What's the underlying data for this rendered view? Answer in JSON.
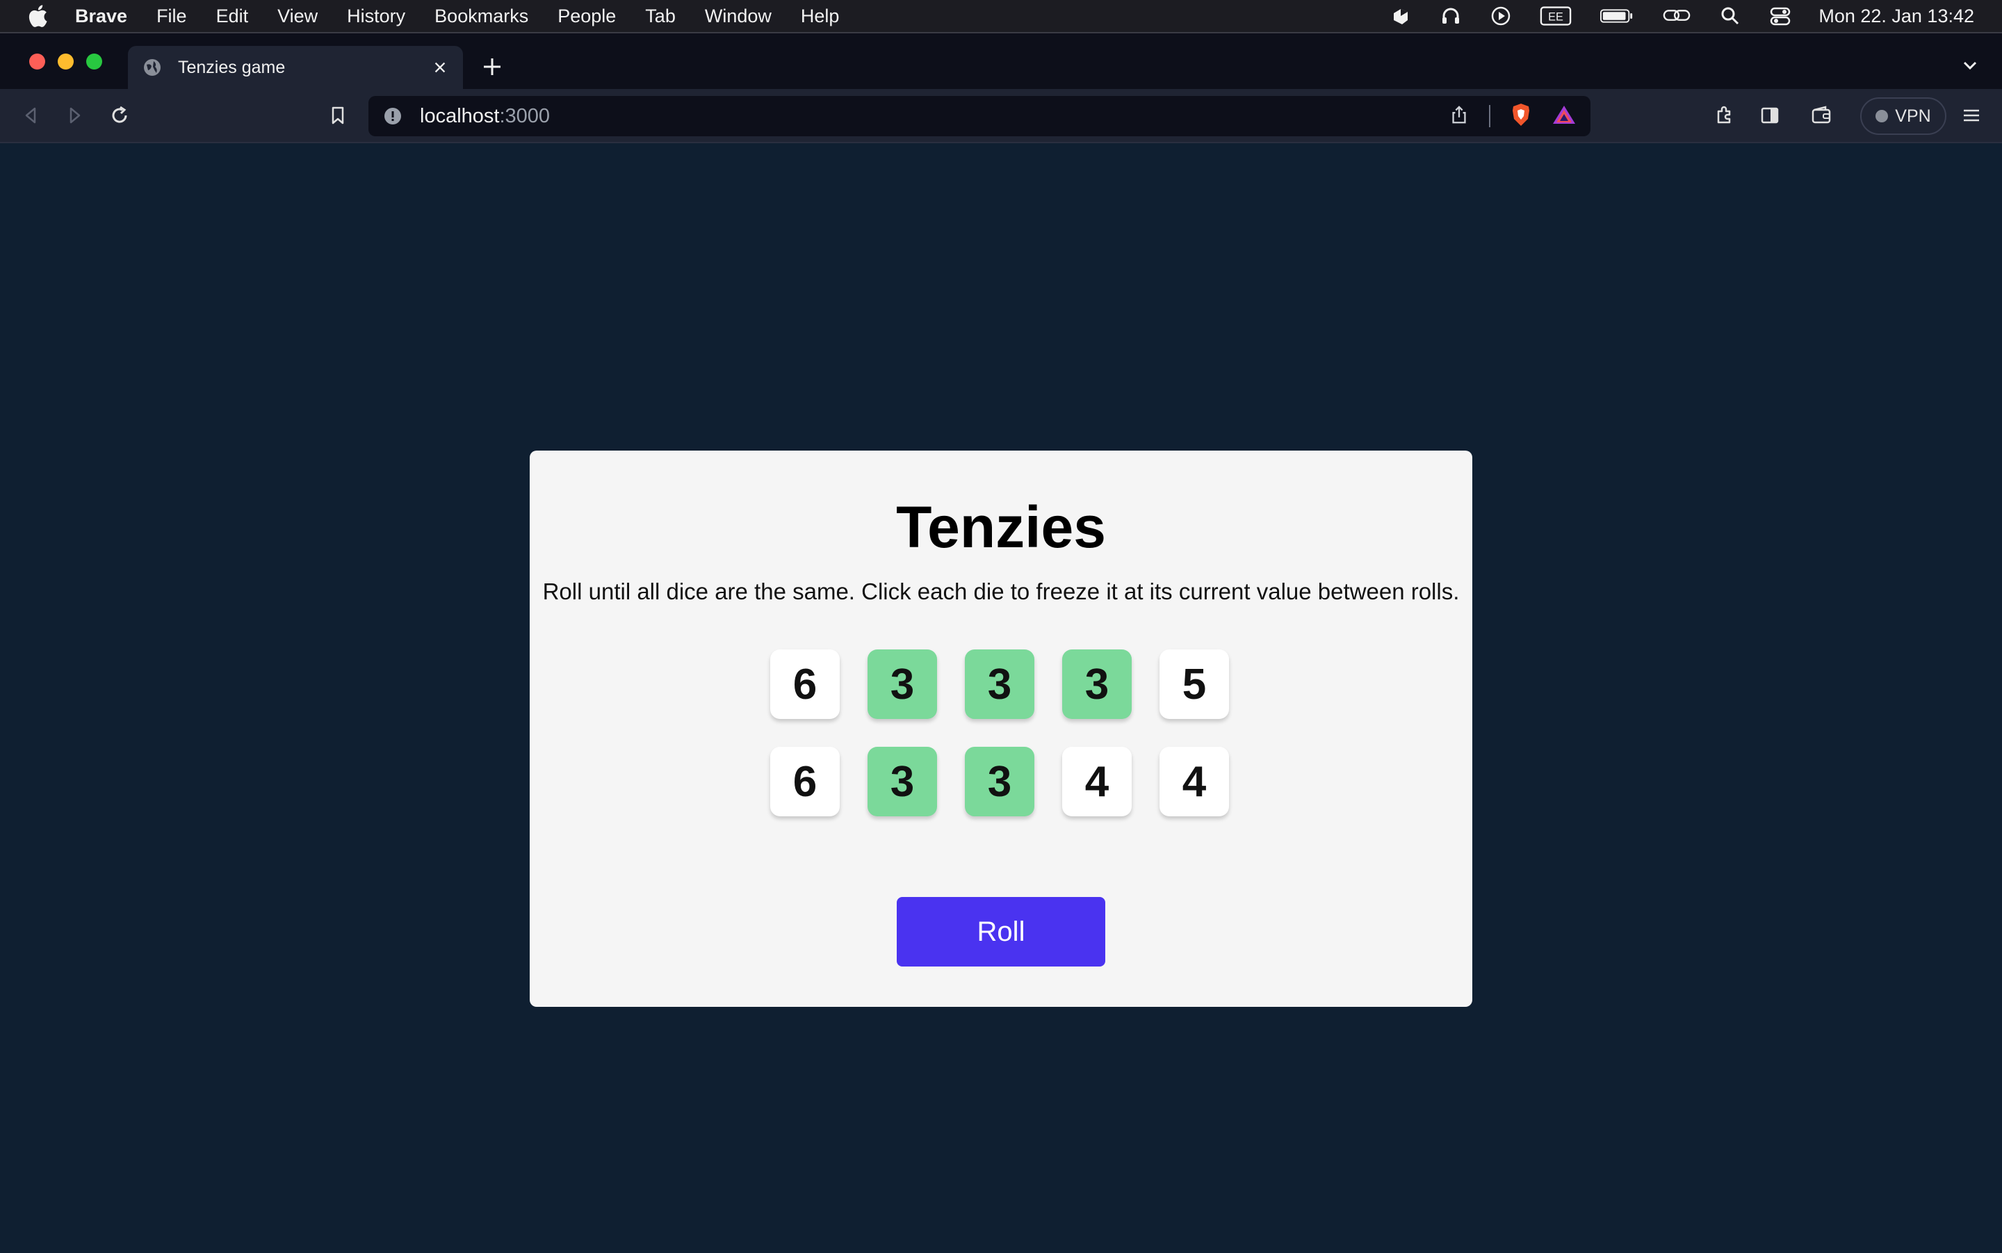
{
  "menubar": {
    "items": [
      "Brave",
      "File",
      "Edit",
      "View",
      "History",
      "Bookmarks",
      "People",
      "Tab",
      "Window",
      "Help"
    ],
    "clock": "Mon 22. Jan  13:42",
    "input_indicator": "EE",
    "icons": [
      "apple-icon",
      "brave-talk-icon",
      "headphones-icon",
      "play-icon",
      "keyboard-input-icon",
      "battery-icon",
      "screen-mirroring-icon",
      "search-icon",
      "control-center-icon"
    ]
  },
  "browser": {
    "tab_title": "Tenzies game",
    "url_host": "localhost",
    "url_port": ":3000",
    "vpn_label": "VPN"
  },
  "game": {
    "title": "Tenzies",
    "instructions": "Roll until all dice are the same. Click each die to freeze it at its current value between rolls.",
    "dice": [
      {
        "value": "6",
        "held": false
      },
      {
        "value": "3",
        "held": true
      },
      {
        "value": "3",
        "held": true
      },
      {
        "value": "3",
        "held": true
      },
      {
        "value": "5",
        "held": false
      },
      {
        "value": "6",
        "held": false
      },
      {
        "value": "3",
        "held": true
      },
      {
        "value": "3",
        "held": true
      },
      {
        "value": "4",
        "held": false
      },
      {
        "value": "4",
        "held": false
      }
    ],
    "roll_label": "Roll",
    "colors": {
      "held": "#7bd99a",
      "unheld": "#ffffff",
      "button": "#4a33f0",
      "background": "#0f1f31",
      "card": "#f5f5f5"
    }
  }
}
